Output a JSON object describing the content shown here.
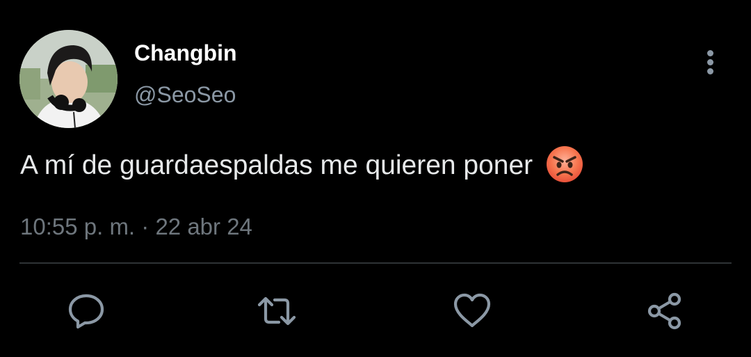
{
  "tweet": {
    "author": {
      "display_name": "Changbin",
      "handle": "@SeoSeo"
    },
    "text": "A mí de guardaespaldas me quieren poner",
    "emoji": "angry-face-emoji",
    "time": "10:55 p. m.",
    "separator": "·",
    "date": "22 abr 24"
  },
  "icons": {
    "more": "vertical-dots-icon",
    "reply": "comment-bubble-icon",
    "retweet": "retweet-icon",
    "like": "heart-icon",
    "share": "share-icon"
  },
  "colors": {
    "background": "#000000",
    "primary_text": "#e7e9ea",
    "secondary_text": "#8b98a5",
    "divider": "#2f3336"
  }
}
